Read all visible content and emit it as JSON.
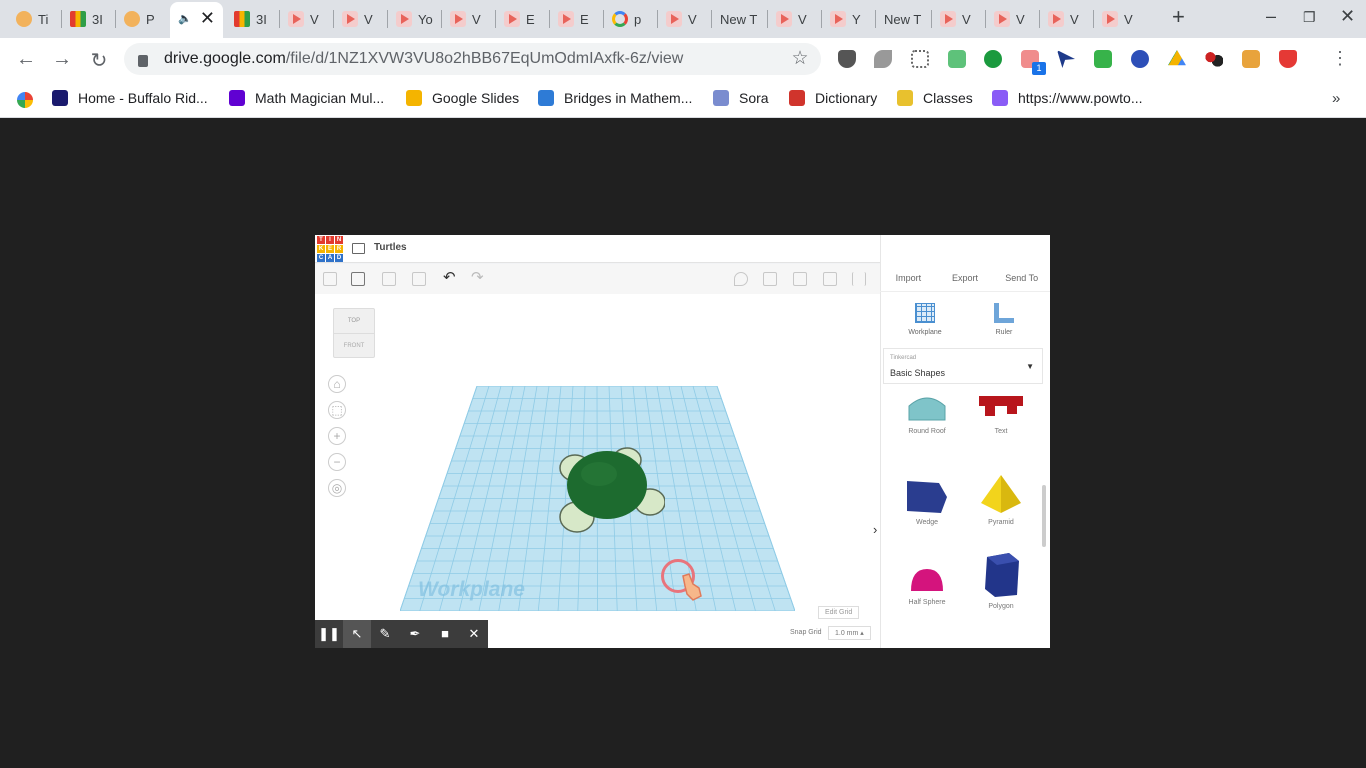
{
  "browser": {
    "tabs": [
      {
        "label": "Ti",
        "favicon": "face-icon"
      },
      {
        "label": "3I",
        "favicon": "grid-icon"
      },
      {
        "label": "P",
        "favicon": "face-icon"
      },
      {
        "label": "",
        "favicon": "speaker-icon",
        "active": true
      },
      {
        "label": "3I",
        "favicon": "grid-icon"
      },
      {
        "label": "V",
        "favicon": "video-icon"
      },
      {
        "label": "V",
        "favicon": "video-icon"
      },
      {
        "label": "Yo",
        "favicon": "video-icon"
      },
      {
        "label": "V",
        "favicon": "video-icon"
      },
      {
        "label": "E",
        "favicon": "video-icon"
      },
      {
        "label": "E",
        "favicon": "video-icon"
      },
      {
        "label": "p",
        "favicon": "google-icon"
      },
      {
        "label": "V",
        "favicon": "video-icon"
      },
      {
        "label": "New T",
        "favicon": ""
      },
      {
        "label": "V",
        "favicon": "video-icon"
      },
      {
        "label": "Y",
        "favicon": "video-icon"
      },
      {
        "label": "New T",
        "favicon": ""
      },
      {
        "label": "V",
        "favicon": "video-icon"
      },
      {
        "label": "V",
        "favicon": "video-icon"
      },
      {
        "label": "V",
        "favicon": "video-icon"
      },
      {
        "label": "V",
        "favicon": "video-icon"
      }
    ],
    "new_tab": "+",
    "url_host": "drive.google.com",
    "url_path": "/file/d/1NZ1XVW3VU8o2hBB67EqUmOdmIAxfk-6z/view",
    "extension_badge": "1",
    "bookmarks": [
      {
        "label": "Home - Buffalo Rid...",
        "color": "#1a1a6e"
      },
      {
        "label": "Math Magician Mul...",
        "color": "#6001d2"
      },
      {
        "label": "Google Slides",
        "color": "#f4b400"
      },
      {
        "label": "Bridges in Mathem...",
        "color": "#2e7bd6"
      },
      {
        "label": "Sora",
        "color": "#7a8ccf"
      },
      {
        "label": "Dictionary",
        "color": "#d0342c"
      },
      {
        "label": "Classes",
        "color": "#e8c12e"
      },
      {
        "label": "https://www.powto...",
        "color": "#8a5cf6"
      }
    ],
    "bookmarks_more": "»"
  },
  "tinkercad": {
    "logo_letters": [
      "T",
      "I",
      "N",
      "K",
      "E",
      "R",
      "C",
      "A",
      "D"
    ],
    "title": "Turtles",
    "top_actions": [
      "Import",
      "Export",
      "Send To"
    ],
    "workplane_tool": "Workplane",
    "ruler_tool": "Ruler",
    "library_caption": "Tinkercad",
    "library_value": "Basic Shapes",
    "shapes": [
      {
        "label": "Round Roof",
        "color": "#7fc4c9"
      },
      {
        "label": "Text",
        "color": "#b8161c"
      },
      {
        "label": "Wedge",
        "color": "#2a3d8f"
      },
      {
        "label": "Pyramid",
        "color": "#f2d41c"
      },
      {
        "label": "Half Sphere",
        "color": "#d4147d"
      },
      {
        "label": "Polygon",
        "color": "#22358a"
      }
    ],
    "viewcube_top": "TOP",
    "viewcube_front": "FRONT",
    "workplane_label": "Workplane",
    "edit_grid": "Edit Grid",
    "snap_grid_label": "Snap Grid",
    "snap_grid_value": "1.0 mm ▴"
  },
  "colors": {
    "workplane": "#bfe3f2",
    "turtle_shell": "#1d6b2f",
    "turtle_limb": "#d7e8c8"
  }
}
